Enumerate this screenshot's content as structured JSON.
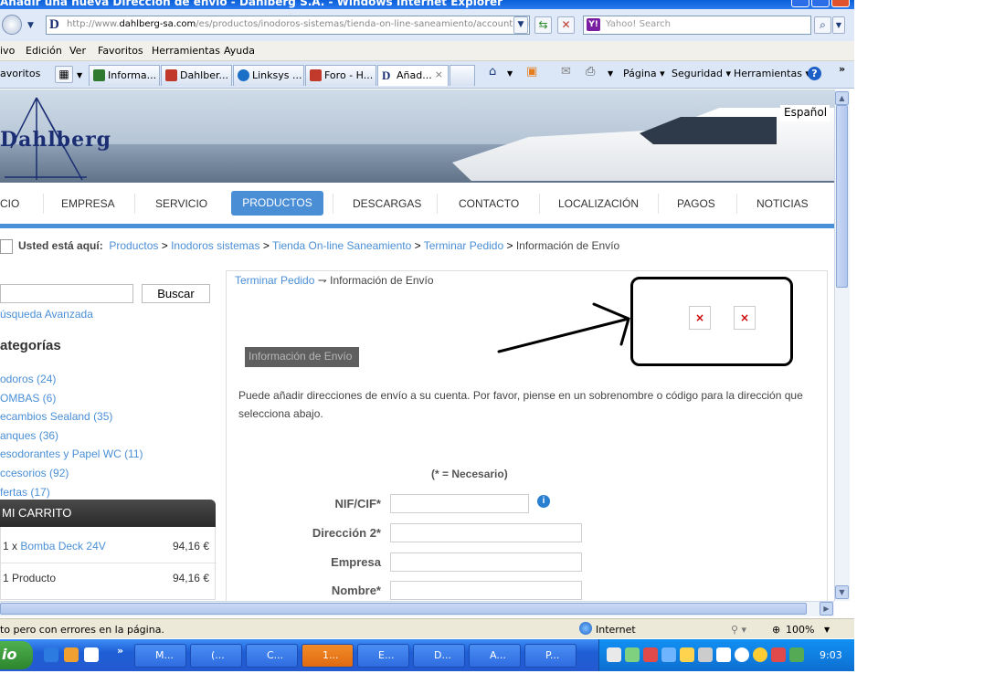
{
  "window": {
    "title": "Añadir una nueva Dirección de envío - Dahlberg S.A. - Windows Internet Explorer"
  },
  "addressbar": {
    "url_prefix": "http://www.",
    "url_host": "dahlberg-sa.com",
    "url_rest": "/es/productos/inodoros-sistemas/tienda-on-line-saneamiento/account-shipt",
    "search_placeholder": "Yahoo! Search",
    "yahoo_badge": "Y!"
  },
  "menubar": {
    "items": [
      "ivo",
      "Edición",
      "Ver",
      "Favoritos",
      "Herramientas",
      "Ayuda"
    ]
  },
  "tabs": {
    "favorites_label": "avoritos",
    "items": [
      {
        "label": "Informa...",
        "color": "#2f7a2f"
      },
      {
        "label": "Dahlber...",
        "color": "#c0392b"
      },
      {
        "label": "Linksys ...",
        "color": "#1b6fc7"
      },
      {
        "label": "Foro - H...",
        "color": "#c0392b"
      },
      {
        "label": "Añad...",
        "color": "#1b2e73"
      }
    ],
    "close_glyph": "×",
    "tools": [
      "Página ▾",
      "Seguridad ▾",
      "Herramientas ▾"
    ]
  },
  "header": {
    "logo": "Dahlberg",
    "language": "Español"
  },
  "nav": {
    "items": [
      "CIO",
      "EMPRESA",
      "SERVICIO",
      "PRODUCTOS",
      "DESCARGAS",
      "CONTACTO",
      "LOCALIZACIÓN",
      "PAGOS",
      "NOTICIAS"
    ],
    "active": "PRODUCTOS"
  },
  "breadcrumb": {
    "prefix": "Usted está aquí:",
    "links": [
      "Productos",
      "Inodoros sistemas",
      "Tienda On-line Saneamiento",
      "Terminar Pedido"
    ],
    "sep": " > ",
    "current": "Información de Envío"
  },
  "sidebar": {
    "search_button": "Buscar",
    "advanced_search": "úsqueda Avanzada",
    "categories_title": "ategorías",
    "categories": [
      "odoros (24)",
      "OMBAS (6)",
      "ecambios Sealand (35)",
      "anques (36)",
      "esodorantes y Papel WC (11)",
      "ccesorios (92)",
      "fertas (17)"
    ],
    "cart_title": "MI CARRITO",
    "cart_qty": "1 x",
    "cart_item": "Bomba Deck 24V",
    "cart_item_price": "94,16 €",
    "cart_summary": "1 Producto",
    "cart_total": "94,16 €"
  },
  "main": {
    "subcrumb_link": "Terminar Pedido",
    "subcrumb_sep": "⇁",
    "subcrumb_current": "Información de Envío",
    "section_badge": "Información de Envío",
    "paragraph": "Puede añadir direcciones de envío a su cuenta. Por favor, piense en un sobrenombre o código para la dirección que selecciona abajo.",
    "required_note": "(* = Necesario)",
    "fields": [
      {
        "label": "NIF/CIF*",
        "value": ""
      },
      {
        "label": "Dirección 2*",
        "value": ""
      },
      {
        "label": "Empresa",
        "value": ""
      },
      {
        "label": "Nombre*",
        "value": ""
      }
    ],
    "info_glyph": "i",
    "broken_image_glyph": "×"
  },
  "statusbar": {
    "message": "to pero con errores en la página.",
    "zone": "Internet",
    "zoom": "100%"
  },
  "taskbar": {
    "start_label": "io",
    "buttons": [
      "M...",
      "(...",
      "C...",
      "1...",
      "E...",
      "D...",
      "A...",
      "P..."
    ],
    "active_index": 3,
    "clock": "9:03"
  },
  "colors": {
    "accent": "#4a8fd6",
    "nav_underline": "#4a90d9",
    "annotation": "#000000"
  }
}
